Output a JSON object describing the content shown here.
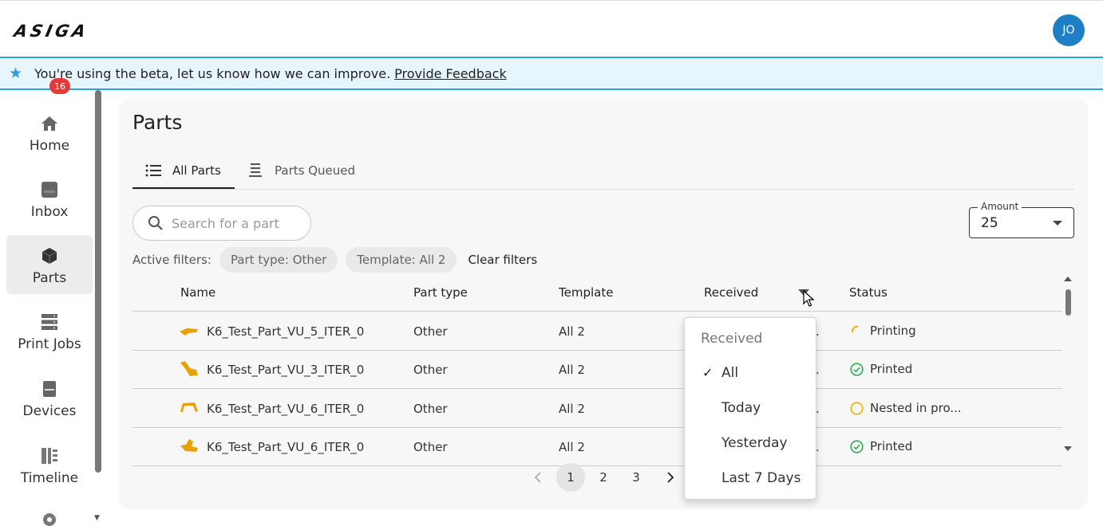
{
  "app": {
    "logo_text": "ASIGA",
    "avatar_initials": "JO"
  },
  "banner": {
    "message": "You're using the beta, let us know how we can improve.",
    "link_text": "Provide Feedback"
  },
  "sidebar": {
    "items": [
      {
        "label": "Home"
      },
      {
        "label": "Inbox",
        "badge": "16"
      },
      {
        "label": "Parts"
      },
      {
        "label": "Print Jobs"
      },
      {
        "label": "Devices"
      },
      {
        "label": "Timeline"
      }
    ]
  },
  "main": {
    "title": "Parts",
    "tabs": [
      {
        "label": "All Parts"
      },
      {
        "label": "Parts Queued"
      }
    ],
    "search": {
      "placeholder": "Search for a part"
    },
    "amount": {
      "label": "Amount",
      "value": "25"
    },
    "filters": {
      "label": "Active filters:",
      "chips": [
        "Part type: Other",
        "Template: All 2"
      ],
      "clear": "Clear filters"
    },
    "table": {
      "columns": [
        "Name",
        "Part type",
        "Template",
        "Received",
        "Status"
      ],
      "rows": [
        {
          "name": "K6_Test_Part_VU_5_ITER_0",
          "part_type": "Other",
          "template": "All 2",
          "received": ".",
          "status": "Printing"
        },
        {
          "name": "K6_Test_Part_VU_3_ITER_0",
          "part_type": "Other",
          "template": "All 2",
          "received": ".",
          "status": "Printed"
        },
        {
          "name": "K6_Test_Part_VU_6_ITER_0",
          "part_type": "Other",
          "template": "All 2",
          "received": ".",
          "status": "Nested in pro..."
        },
        {
          "name": "K6_Test_Part_VU_6_ITER_0",
          "part_type": "Other",
          "template": "All 2",
          "received": ".",
          "status": "Printed"
        }
      ]
    },
    "pagination": {
      "pages": [
        "1",
        "2",
        "3"
      ],
      "current": "1"
    }
  },
  "received_menu": {
    "header": "Received",
    "options": [
      "All",
      "Today",
      "Yesterday",
      "Last 7 Days"
    ],
    "selected": "All"
  },
  "colors": {
    "accent": "#1f7fc4",
    "banner_bg": "#e7f6fd",
    "banner_border": "#2ea3dd",
    "badge": "#e53935",
    "printed": "#2eaa4f",
    "nested": "#f0b100",
    "printing": "#f0b100",
    "part_thumb": "#e8a200"
  }
}
